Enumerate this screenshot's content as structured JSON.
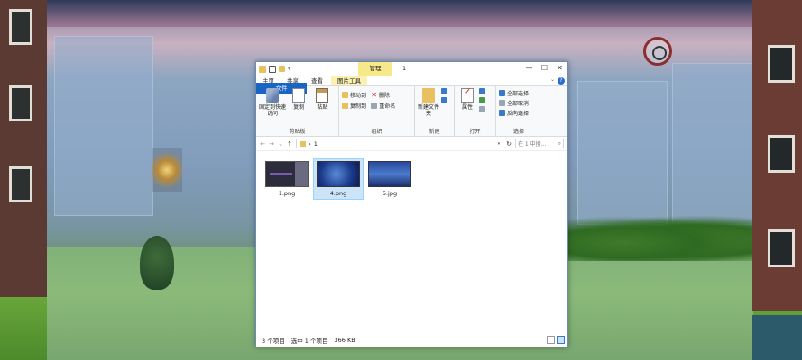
{
  "window": {
    "manage_tab": "管理",
    "title": "1",
    "minimize_glyph": "—",
    "maximize_glyph": "☐",
    "close_glyph": "✕"
  },
  "tabs": [
    "文件",
    "主页",
    "共享",
    "查看",
    "图片工具"
  ],
  "help_glyph": "?",
  "collapse_glyph": "⌄",
  "ribbon": {
    "clipboard": {
      "pin_label": "固定到快速访问",
      "copy_label": "复制",
      "paste_label": "粘贴",
      "group_name": "剪贴板"
    },
    "organize": {
      "move_to": "移动到",
      "copy_to": "复制到",
      "delete": "删除",
      "rename": "重命名",
      "group_name": "组织"
    },
    "new": {
      "new_folder": "新建文件夹",
      "group_name": "新建"
    },
    "open": {
      "properties": "属性",
      "group_name": "打开"
    },
    "select": {
      "select_all": "全部选择",
      "select_none": "全部取消",
      "invert": "反向选择",
      "group_name": "选择"
    }
  },
  "address": {
    "back": "←",
    "forward": "→",
    "recent": "⌄",
    "up": "↑",
    "path_sep": "›",
    "path": "1",
    "refresh": "↻",
    "search_placeholder": "在 1 中搜...",
    "search_glyph": "⌕"
  },
  "files": [
    {
      "name": "1.png",
      "selected": false
    },
    {
      "name": "4.png",
      "selected": true
    },
    {
      "name": "5.jpg",
      "selected": false
    }
  ],
  "status": {
    "count": "3 个项目",
    "selected": "选中 1 个项目",
    "size": "366 KB"
  },
  "colors": {
    "file_tab": "#1a64c4",
    "manage_tab": "#f7e88a",
    "selection": "#cce4f7"
  }
}
